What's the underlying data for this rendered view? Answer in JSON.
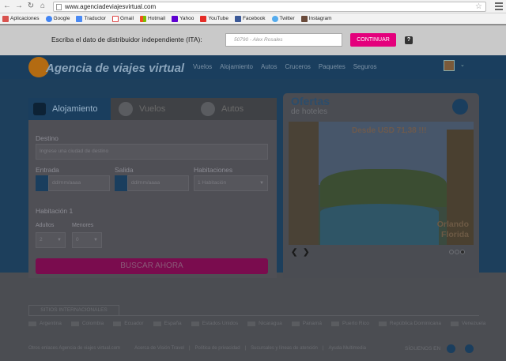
{
  "browser": {
    "url": "www.agenciadeviajesvirtual.com",
    "bookmarks": [
      "Aplicaciones",
      "Google",
      "Traductor",
      "Gmail",
      "Hotmail",
      "Yahoo",
      "YouTube",
      "Facebook",
      "Twitter",
      "Instagram"
    ]
  },
  "ita": {
    "label": "Escriba el dato de distribuidor independiente (ITA):",
    "input_value": "50790 - Alex Rosales",
    "button": "CONTINUAR",
    "help": "?"
  },
  "header": {
    "logo": "Agencia de viajes virtual",
    "nav": [
      "Vuelos",
      "Alojamiento",
      "Autos",
      "Cruceros",
      "Paquetes",
      "Seguros"
    ]
  },
  "search": {
    "tabs": [
      "Alojamiento",
      "Vuelos",
      "Autos"
    ],
    "destino_label": "Destino",
    "destino_placeholder": "Ingrese una ciudad de destino",
    "entrada_label": "Entrada",
    "salida_label": "Salida",
    "habitaciones_label": "Habitaciones",
    "entrada_placeholder": "dd/mm/aaaa",
    "salida_placeholder": "dd/mm/aaaa",
    "habitaciones_value": "1 Habitación",
    "habitacion_title": "Habitación 1",
    "adultos_label": "Adultos",
    "menores_label": "Menores",
    "adultos_value": "2",
    "menores_value": "0",
    "button": "BUSCAR AHORA"
  },
  "offers": {
    "title": "Ofertas",
    "subtitle": "de hoteles",
    "price": "Desde USD 71,38 !!!",
    "city_line1": "Orlando",
    "city_line2": "Florida",
    "prev": "❮",
    "next": "❯"
  },
  "footer": {
    "intl_tab": "SITIOS INTERNACIONALES",
    "countries": [
      "Argentina",
      "Colombia",
      "Ecuador",
      "España",
      "Estados Unidos",
      "Nicaragua",
      "Panamá",
      "Puerto Rico",
      "República Dominicana",
      "Venezuela"
    ],
    "links": [
      "Otros enlaces Agencia de viajes virtual.com",
      "Acerca de Visión Travel",
      "Política de privacidad",
      "Sucursales y líneas de atención",
      "Ayuda Multimedia"
    ],
    "social": "SÍGUENOS EN"
  }
}
